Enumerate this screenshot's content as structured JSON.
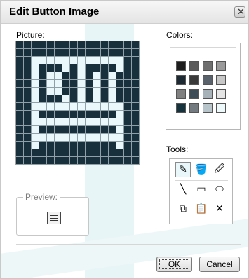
{
  "window": {
    "title": "Edit Button Image"
  },
  "picture": {
    "label": "Picture:",
    "rows": [
      "DDDDDDDDDDDDDDDD",
      "DDDDDDDDDDDDDDDD",
      "DDLLLLLLLLLLLLDD",
      "DDLDDDLDLDDDDLDD",
      "DDLDLLDDLDLDLDDD",
      "DDLDLLDDLDLDLDDD",
      "DDLDLLDDLDLDLDDD",
      "DDLDDDLDLDLDLDDD",
      "DDLLLLLLLLLLLLDD",
      "DDLDDDDDDDDDDLDD",
      "DDLLLLLLLLLLLLDD",
      "DDLDDDDDDDDDDLDD",
      "DDLLLLLLLLLLLLDD",
      "DDLDDDDDDDDDDLDD",
      "DDDDDDDDDDDDDDDD",
      "DDDDDDDDDDDDDDDD"
    ],
    "colors": {
      "dark": "#17303b",
      "light": "#eaf8fb"
    }
  },
  "colors": {
    "label": "Colors:",
    "swatches": [
      "#1d1d1d",
      "#5b5b5b",
      "#6f6f6f",
      "#9a9a9a",
      "#1e2a33",
      "#3a3a3a",
      "#59626a",
      "#c7c7c7",
      "#808080",
      "#3c4b56",
      "#a7b2b8",
      "#e5e5e5",
      "#16323d",
      "#737b80",
      "#b7c5ca",
      "#eef9fb"
    ],
    "selected_index": 12
  },
  "tools": {
    "label": "Tools:",
    "items": [
      {
        "name": "pencil-icon",
        "glyph": "✎"
      },
      {
        "name": "fill-bucket-icon",
        "glyph": "🪣"
      },
      {
        "name": "eyedropper-icon",
        "glyph": "🖉"
      },
      {
        "name": "line-icon",
        "glyph": "╲"
      },
      {
        "name": "rectangle-icon",
        "glyph": "▭"
      },
      {
        "name": "ellipse-icon",
        "glyph": "⬭"
      },
      {
        "name": "copy-icon",
        "glyph": "⧉"
      },
      {
        "name": "paste-icon",
        "glyph": "📋"
      },
      {
        "name": "clear-icon",
        "glyph": "✕"
      }
    ],
    "active_index": 0
  },
  "preview": {
    "label": "Preview:"
  },
  "buttons": {
    "ok": "OK",
    "cancel": "Cancel"
  },
  "close_glyph": "✕"
}
